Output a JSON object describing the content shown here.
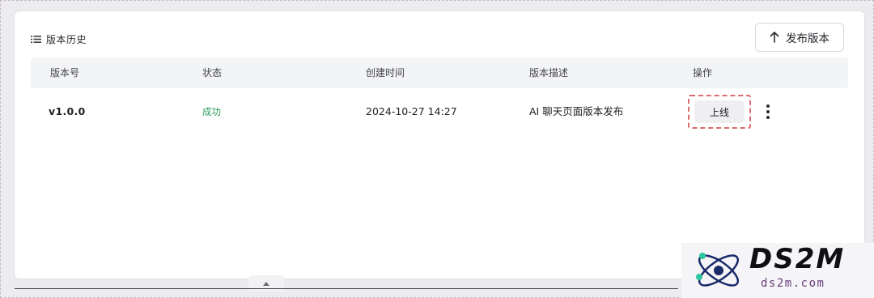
{
  "header": {
    "title": "版本历史",
    "icon": "list-icon"
  },
  "toolbar": {
    "publish_label": "发布版本",
    "publish_icon": "arrow-up-icon"
  },
  "table": {
    "columns": [
      "版本号",
      "状态",
      "创建时间",
      "版本描述",
      "操作"
    ],
    "rows": [
      {
        "version": "v1.0.0",
        "status": "成功",
        "created_at": "2024-10-27 14:27",
        "description": "AI 聊天页面版本发布",
        "action_label": "上线"
      }
    ]
  },
  "colors": {
    "status_success": "#2c9d5a",
    "highlight_border": "#d86b6b",
    "header_bg": "#f3f4f6"
  },
  "watermark": {
    "brand": "DS2M",
    "domain": "ds2m.com"
  }
}
